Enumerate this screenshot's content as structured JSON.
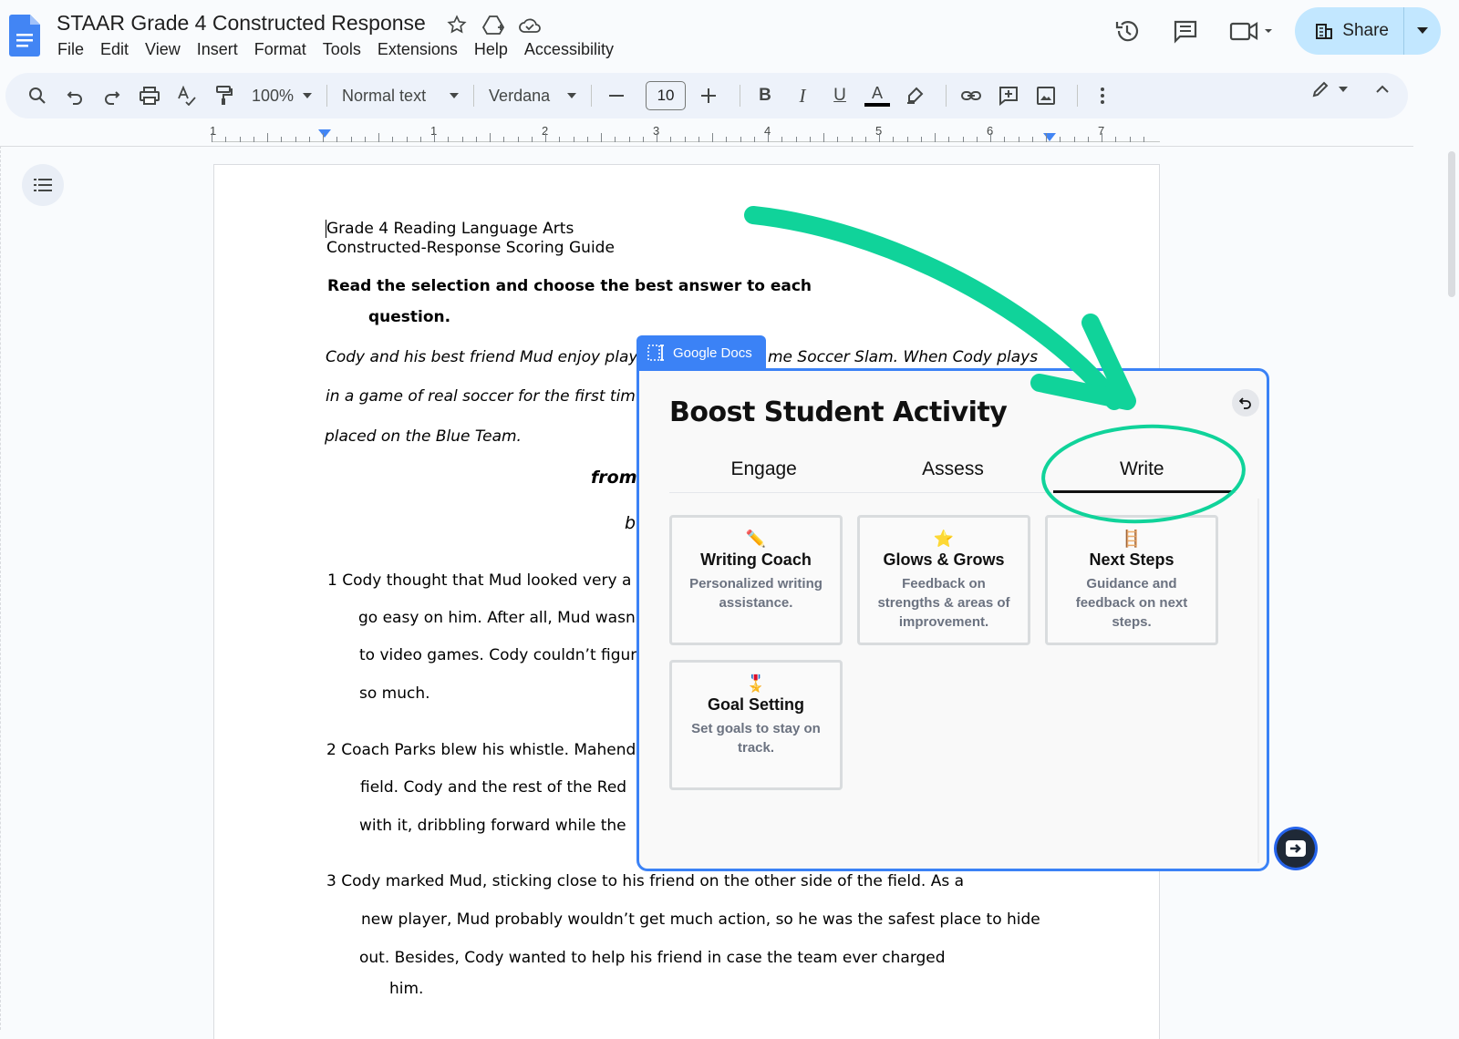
{
  "document": {
    "title": "STAAR Grade 4 Constructed Response"
  },
  "menu": [
    "File",
    "Edit",
    "View",
    "Insert",
    "Format",
    "Tools",
    "Extensions",
    "Help",
    "Accessibility"
  ],
  "share": {
    "label": "Share"
  },
  "toolbar": {
    "zoom": "100%",
    "style": "Normal text",
    "font": "Verdana",
    "font_size": "10",
    "bold": "B",
    "italic": "I",
    "underline": "U",
    "text_color": "A"
  },
  "ruler": {
    "labels": [
      "1",
      "1",
      "2",
      "3",
      "4",
      "5",
      "6",
      "7"
    ]
  },
  "doc_lines": {
    "l1": "Grade 4 Reading Language Arts",
    "l2": "Constructed-Response Scoring Guide",
    "l3": "Read the selection and choose the best answer to each",
    "l4": "question.",
    "l5a": "Cody and his best friend Mud enjoy play",
    "l5b": "me Soccer Slam. When Cody plays",
    "l6": "in a game of real soccer for the first tim",
    "l7": "placed on the Blue Team.",
    "l8": "from",
    "l9": "b",
    "p1a": "1 Cody thought that Mud looked very a",
    "p1b": "go easy on him. After all, Mud wasn",
    "p1c": "to video games. Cody couldn’t figur",
    "p1d": "so much.",
    "p2a": "2 Coach Parks blew his whistle. Mahend",
    "p2b": "field. Cody and the rest of the Red",
    "p2c": "with it, dribbling forward while the",
    "p3a": "3 Cody marked Mud, sticking close to his friend on the other side of the field. As a",
    "p3b": "new player, Mud probably wouldn’t get much action, so he was the safest place to hide",
    "p3c": "out. Besides, Cody wanted to help his friend in case the team ever charged",
    "p3d": "him."
  },
  "extension": {
    "tab_label": "Google Docs",
    "title": "Boost Student Activity",
    "tabs": [
      "Engage",
      "Assess",
      "Write"
    ],
    "active_tab": "Write",
    "cards": [
      {
        "emoji": "✏️",
        "title": "Writing Coach",
        "desc": "Personalized writing assistance."
      },
      {
        "emoji": "⭐",
        "title": "Glows & Grows",
        "desc": "Feedback on strengths & areas of improvement."
      },
      {
        "emoji": "🪜",
        "title": "Next Steps",
        "desc": "Guidance and feedback on next steps."
      },
      {
        "emoji": "🎖️",
        "title": "Goal Setting",
        "desc": "Set goals to stay on track."
      }
    ]
  },
  "colors": {
    "accent_blue": "#3b82f6",
    "share_bg": "#c2e7ff",
    "annotation_green": "#10d39a"
  }
}
